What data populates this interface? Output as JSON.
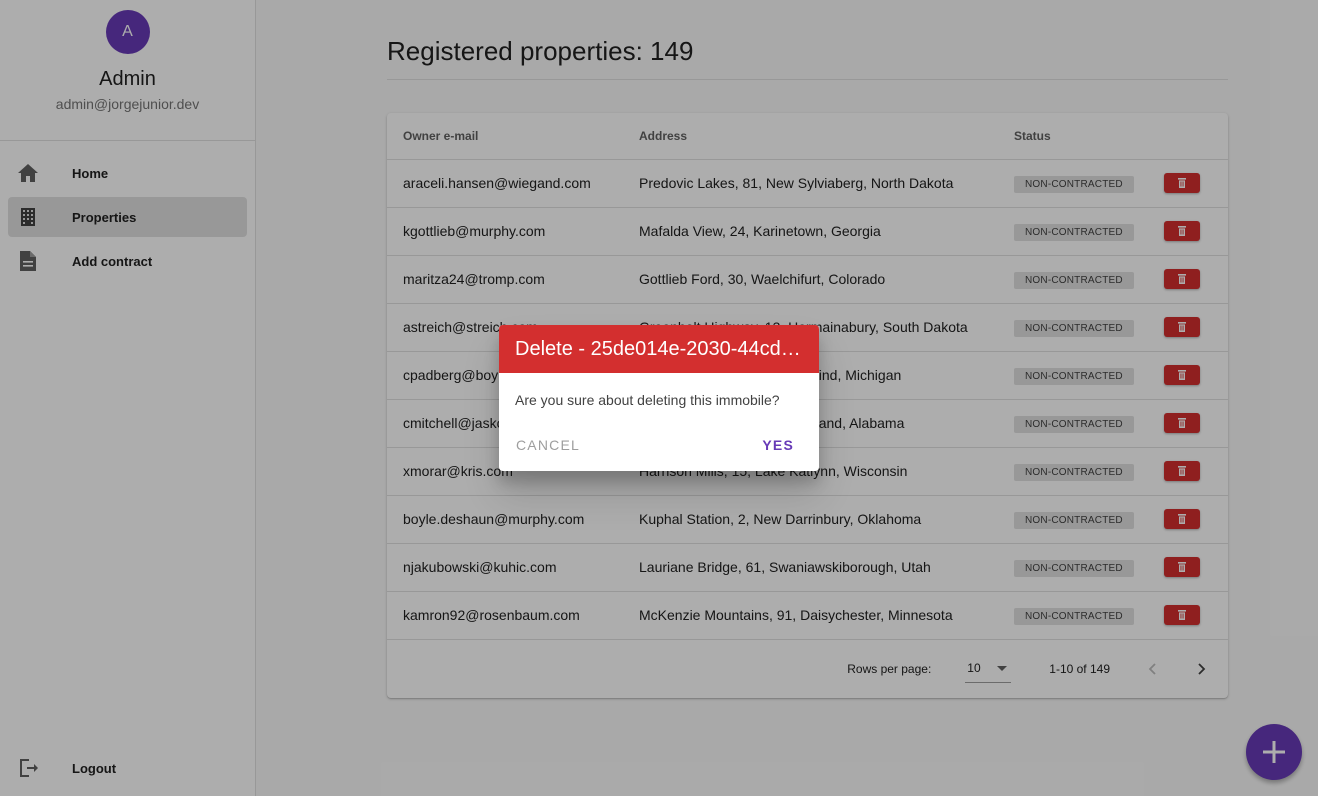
{
  "user": {
    "avatar_letter": "A",
    "name": "Admin",
    "email": "admin@jorgejunior.dev"
  },
  "nav": {
    "items": [
      {
        "label": "Home",
        "icon": "home-icon"
      },
      {
        "label": "Properties",
        "icon": "building-icon",
        "active": true
      },
      {
        "label": "Add contract",
        "icon": "document-icon"
      }
    ],
    "logout": {
      "label": "Logout",
      "icon": "logout-icon"
    }
  },
  "page": {
    "title": "Registered properties: 149"
  },
  "table": {
    "headers": {
      "owner": "Owner e-mail",
      "address": "Address",
      "status": "Status"
    },
    "rows": [
      {
        "owner": "araceli.hansen@wiegand.com",
        "address": "Predovic Lakes, 81, New Sylviaberg, North Dakota",
        "status": "NON-CONTRACTED"
      },
      {
        "owner": "kgottlieb@murphy.com",
        "address": "Mafalda View, 24, Karinetown, Georgia",
        "status": "NON-CONTRACTED"
      },
      {
        "owner": "maritza24@tromp.com",
        "address": "Gottlieb Ford, 30, Waelchifurt, Colorado",
        "status": "NON-CONTRACTED"
      },
      {
        "owner": "astreich@streich.com",
        "address": "Greenholt Highway, 13, Hermainabury, South Dakota",
        "status": "NON-CONTRACTED"
      },
      {
        "owner": "cpadberg@boyle.com",
        "address": "Keebler Inlet, 44, Lake Rosalind, Michigan",
        "status": "NON-CONTRACTED"
      },
      {
        "owner": "cmitchell@jaskolski.com",
        "address": "Ortiz Plains, 67, North Cleveland, Alabama",
        "status": "NON-CONTRACTED"
      },
      {
        "owner": "xmorar@kris.com",
        "address": "Harrison Mills, 15, Lake Katlynn, Wisconsin",
        "status": "NON-CONTRACTED"
      },
      {
        "owner": "boyle.deshaun@murphy.com",
        "address": "Kuphal Station, 2, New Darrinbury, Oklahoma",
        "status": "NON-CONTRACTED"
      },
      {
        "owner": "njakubowski@kuhic.com",
        "address": "Lauriane Bridge, 61, Swaniawskiborough, Utah",
        "status": "NON-CONTRACTED"
      },
      {
        "owner": "kamron92@rosenbaum.com",
        "address": "McKenzie Mountains, 91, Daisychester, Minnesota",
        "status": "NON-CONTRACTED"
      }
    ],
    "delete_icon": "trash-icon"
  },
  "pagination": {
    "rows_label": "Rows per page:",
    "rows_value": "10",
    "range": "1-10 of 149"
  },
  "fab": {
    "icon": "plus-icon"
  },
  "dialog": {
    "title": "Delete - 25de014e-2030-44cd-...",
    "message": "Are you sure about deleting this immobile?",
    "cancel": "CANCEL",
    "confirm": "YES"
  },
  "colors": {
    "primary": "#673ab7",
    "danger": "#d32f2f"
  }
}
